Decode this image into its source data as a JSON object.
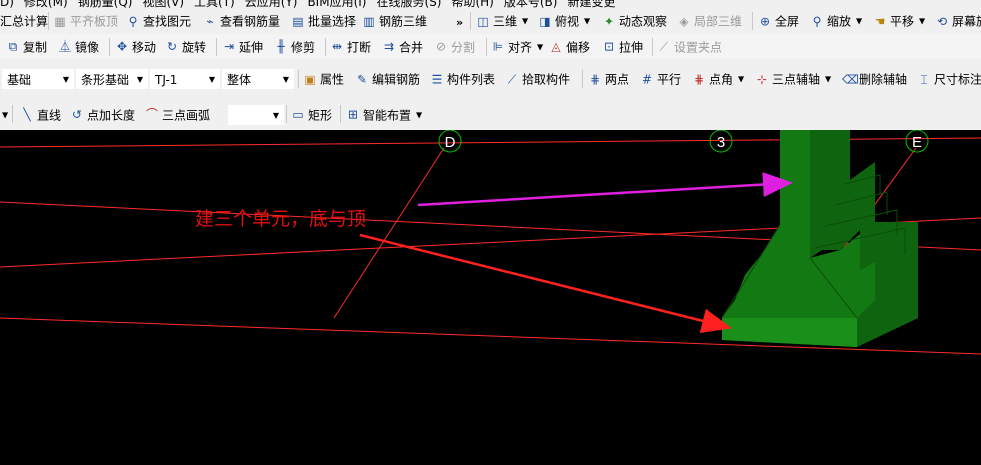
{
  "menu": [
    "D)",
    "修改(M)",
    "钢筋量(Q)",
    "视图(V)",
    "工具(T)",
    "云应用(Y)",
    "BIM应用(I)",
    "在线服务(S)",
    "帮助(H)",
    "版本号(B)",
    "新建变更"
  ],
  "toolbar1": {
    "summary_calc": "汇总计算",
    "flat_slab_top": "平齐板顶",
    "find_element": "查找图元",
    "view_rebar_qty": "查看钢筋量",
    "batch_select": "批量选择",
    "rebar_3d": "钢筋三维",
    "view_3d": "三维",
    "top_view": "俯视",
    "dynamic_view": "动态观察",
    "local_3d": "局部三维",
    "fullscreen": "全屏",
    "zoom": "缩放",
    "pan": "平移",
    "screen_rotate": "屏幕旋"
  },
  "toolbar2": {
    "copy": "复制",
    "mirror": "镜像",
    "move": "移动",
    "rotate": "旋转",
    "extend": "延伸",
    "trim": "修剪",
    "break": "打断",
    "merge": "合并",
    "split": "分割",
    "align": "对齐",
    "offset": "偏移",
    "stretch": "拉伸",
    "set_grip": "设置夹点"
  },
  "toolbar3": {
    "layer_select": "基础",
    "type_select": "条形基础",
    "element_select": "TJ-1",
    "part_select": "整体",
    "properties": "属性",
    "edit_rebar": "编辑钢筋",
    "element_list": "构件列表",
    "pick_element": "拾取构件",
    "two_points": "两点",
    "parallel": "平行",
    "point_angle": "点角",
    "three_point_aux": "三点辅轴",
    "delete_aux": "删除辅轴",
    "dim_label": "尺寸标注"
  },
  "toolbar4": {
    "line": "直线",
    "point_length": "点加长度",
    "three_point_arc": "三点画弧",
    "arc_select": "",
    "rectangle": "矩形",
    "smart_layout": "智能布置"
  },
  "viewport": {
    "grid_labels": [
      "D",
      "3",
      "E"
    ],
    "annotation": "建三个单元，底与顶"
  },
  "colors": {
    "background": "#000000",
    "grid_line": "#ff2a2a",
    "grid_circle": "#00c000",
    "footing_light": "#1f8a1f",
    "footing_dark": "#0f5e0f",
    "arrow_magenta": "#e020e0",
    "arrow_red": "#ff2020"
  }
}
